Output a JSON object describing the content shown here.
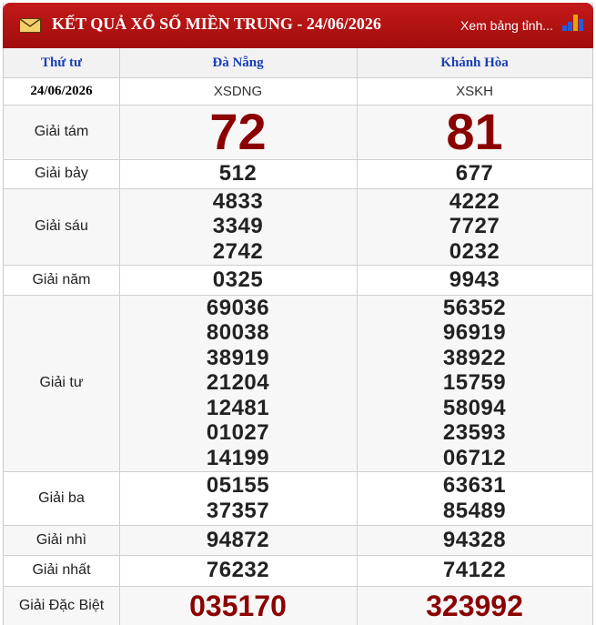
{
  "header": {
    "title": "KẾT QUẢ XỔ SỐ MIỀN TRUNG - 24/06/2026",
    "link_label": "Xem bảng tỉnh...",
    "mail_icon": "envelope-icon",
    "chart_icon": "bar-chart-icon",
    "background_color": "#b01212"
  },
  "table": {
    "day_label": "Thứ tư",
    "date": "24/06/2026",
    "provinces": [
      {
        "name": "Đà Nẵng",
        "code": "XSDNG"
      },
      {
        "name": "Khánh Hòa",
        "code": "XSKH"
      }
    ],
    "rows": [
      {
        "label": "Giải tám",
        "values": [
          [
            "72"
          ],
          [
            "81"
          ]
        ]
      },
      {
        "label": "Giải bảy",
        "values": [
          [
            "512"
          ],
          [
            "677"
          ]
        ]
      },
      {
        "label": "Giải sáu",
        "values": [
          [
            "4833",
            "3349",
            "2742"
          ],
          [
            "4222",
            "7727",
            "0232"
          ]
        ]
      },
      {
        "label": "Giải năm",
        "values": [
          [
            "0325"
          ],
          [
            "9943"
          ]
        ]
      },
      {
        "label": "Giải tư",
        "values": [
          [
            "69036",
            "80038",
            "38919",
            "21204",
            "12481",
            "01027",
            "14199"
          ],
          [
            "56352",
            "96919",
            "38922",
            "15759",
            "58094",
            "23593",
            "06712"
          ]
        ]
      },
      {
        "label": "Giải ba",
        "values": [
          [
            "05155",
            "37357"
          ],
          [
            "63631",
            "85489"
          ]
        ]
      },
      {
        "label": "Giải nhì",
        "values": [
          [
            "94872"
          ],
          [
            "94328"
          ]
        ]
      },
      {
        "label": "Giải nhất",
        "values": [
          [
            "76232"
          ],
          [
            "74122"
          ]
        ]
      },
      {
        "label": "Giải Đặc Biệt",
        "values": [
          [
            "035170"
          ],
          [
            "323992"
          ]
        ]
      }
    ],
    "colors": {
      "prize_red": "#8b0000",
      "header_blue": "#1a3fb4"
    }
  }
}
